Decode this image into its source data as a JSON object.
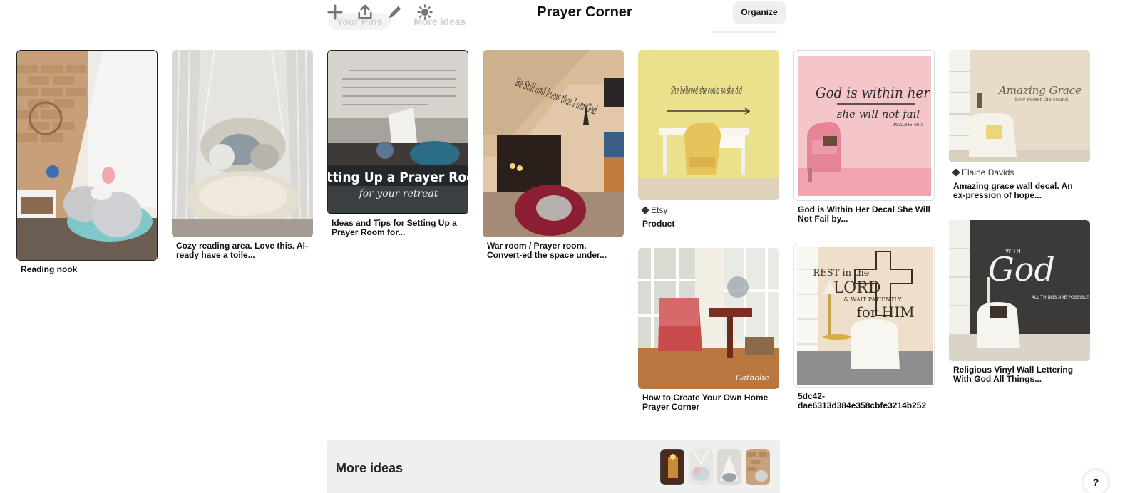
{
  "header": {
    "board_title": "Prayer Corner",
    "organize_label": "Organize",
    "tab_your_pins": "Your Pins",
    "tab_more_ideas": "More ideas"
  },
  "toolbar": {
    "add_icon": "plus-icon",
    "share_icon": "share-icon",
    "edit_icon": "pencil-icon",
    "settings_icon": "sun-icon"
  },
  "pins": [
    {
      "title": "Reading nook"
    },
    {
      "title": "Cozy reading area. Love this. Al-ready have a toile..."
    },
    {
      "title": "Ideas and Tips for Setting Up a Prayer Room for...",
      "overlay_line1": "Setting Up a Prayer Room",
      "overlay_line2": "for your retreat"
    },
    {
      "title": "War room / Prayer room. Convert-ed the space under...",
      "wall_text": "Be Still and know that I am God"
    },
    {
      "title": "Product",
      "source": "Etsy",
      "wall_text": "She believed she could so she did"
    },
    {
      "title": "God is Within Her Decal She Will Not Fail by...",
      "wall_line1": "God is within her",
      "wall_line2": "she will not fail",
      "wall_ref": "PSALMS 46:5"
    },
    {
      "title": "Amazing grace wall decal. An ex-pression of hope...",
      "source": "Elaine Davids",
      "wall_line1": "Amazing Grace",
      "wall_line2": "how sweet the sound"
    },
    {
      "title": "How to Create Your Own Home Prayer Corner",
      "watermark": "Catholic"
    },
    {
      "title": "5dc42-dae6313d384e358cbfe3214b252",
      "wall_line1": "REST in the",
      "wall_line2": "LORD",
      "wall_line3": "& WAIT PATIENTLY",
      "wall_line4": "for HIM"
    },
    {
      "title": "Religious Vinyl Wall Lettering With God All Things...",
      "wall_line1": "WITH",
      "wall_line2": "God",
      "wall_line3": "ALL THINGS ARE POSSIBLE"
    }
  ],
  "more_ideas": {
    "label": "More ideas"
  },
  "help_label": "?"
}
